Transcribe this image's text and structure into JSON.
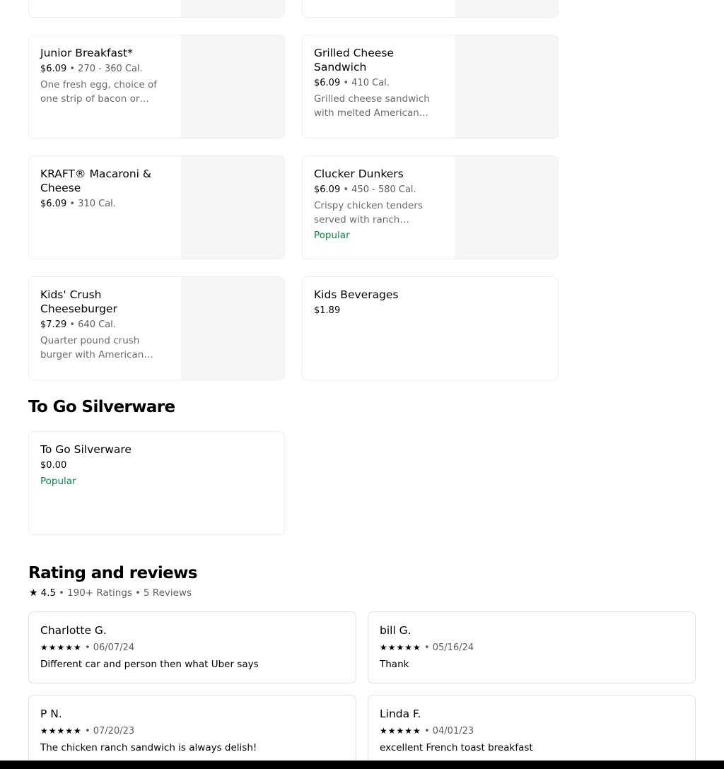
{
  "menu": {
    "items": [
      {
        "name": "Junior Breakfast*",
        "price": "$6.09",
        "separator": "•",
        "calories": "270 - 360 Cal.",
        "description": "One fresh egg, choice of one strip of bacon or sausage..."
      },
      {
        "name": "Grilled Cheese Sandwich",
        "price": "$6.09",
        "separator": "•",
        "calories": "410 Cal.",
        "description": "Grilled cheese sandwich with melted American..."
      },
      {
        "name": "KRAFT® Macaroni & Cheese",
        "price": "$6.09",
        "separator": "•",
        "calories": "310 Cal."
      },
      {
        "name": "Clucker Dunkers",
        "price": "$6.09",
        "separator": "•",
        "calories": "450 - 580 Cal.",
        "description": "Crispy chicken tenders served with ranch dressing.",
        "badge": "Popular"
      },
      {
        "name": "Kids' Crush Cheeseburger",
        "price": "$7.29",
        "separator": "•",
        "calories": "640 Cal.",
        "description": "Quarter pound crush burger with American cheese,..."
      },
      {
        "name": "Kids Beverages",
        "price": "$1.89"
      }
    ]
  },
  "silverware_section": {
    "title": "To Go Silverware",
    "item": {
      "name": "To Go Silverware",
      "price": "$0.00",
      "badge": "Popular"
    }
  },
  "reviews_section": {
    "title": "Rating and reviews",
    "star_icon": "star-icon",
    "rating": "4.5",
    "separator": "•",
    "ratings_count": "190+ Ratings",
    "reviews_count": "5 Reviews",
    "stars_glyph": "★★★★★",
    "reviews": [
      {
        "author": "Charlotte G.",
        "stars": 5,
        "date": "06/07/24",
        "text": "Different car and person then what Uber says"
      },
      {
        "author": "bill G.",
        "stars": 5,
        "date": "05/16/24",
        "text": "Thank"
      },
      {
        "author": "P N.",
        "stars": 5,
        "date": "07/20/23",
        "text": "The chicken ranch sandwich is always delish!"
      },
      {
        "author": "Linda F.",
        "stars": 5,
        "date": "04/01/23",
        "text": "excellent French toast breakfast"
      }
    ]
  },
  "colors": {
    "popular_badge": "#0e8345",
    "card_border": "#eeeeee",
    "image_placeholder": "#f6f6f6"
  }
}
